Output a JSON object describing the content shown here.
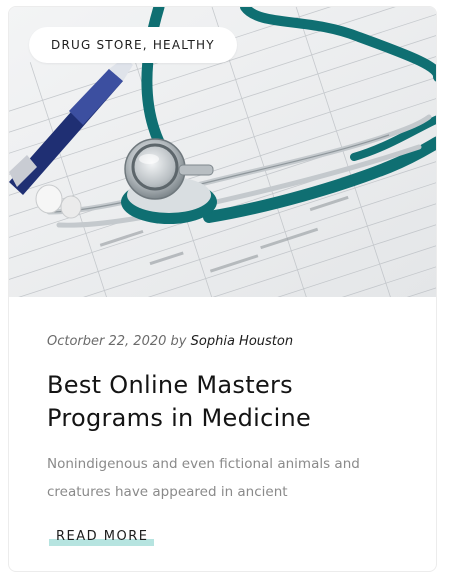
{
  "post": {
    "category": "DRUG STORE, HEALTHY",
    "date": "Octorber 22, 2020",
    "by": "by",
    "author": "Sophia Houston",
    "title": "Best Online Masters Programs in Medicine",
    "excerpt": "Nonindigenous and even fictional animals and creatures have appeared in ancient",
    "read_more": "READ MORE",
    "image": "stethoscope-on-medical-form-photo"
  },
  "colors": {
    "accent_highlight": "#b6e4e0",
    "stethoscope_teal": "#0f6f72",
    "text_dark": "#141414",
    "text_muted": "#8a8a8a"
  }
}
